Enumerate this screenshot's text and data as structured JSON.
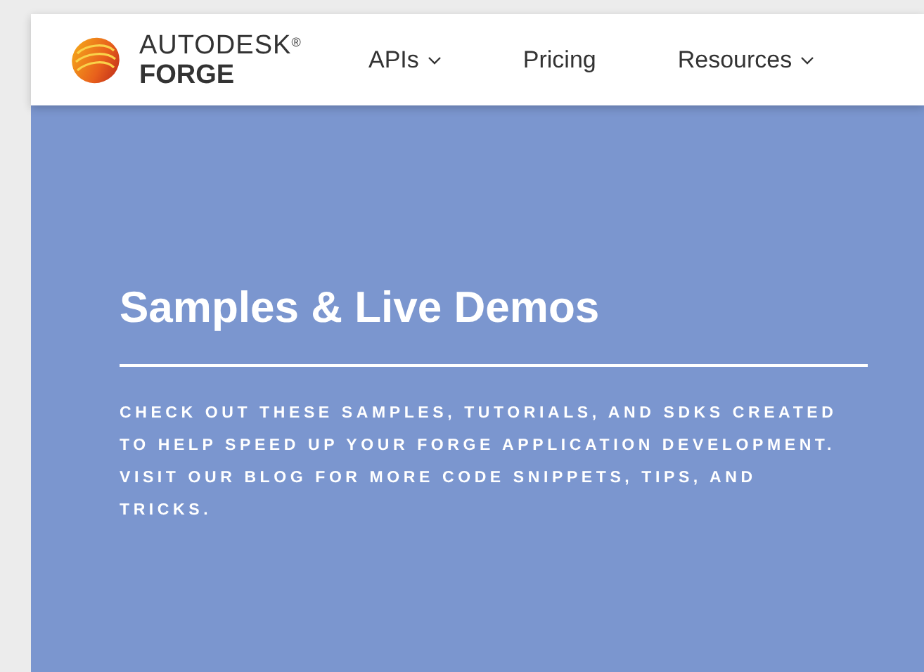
{
  "header": {
    "logo": {
      "brand": "AUTODESK",
      "registered": "®",
      "product": "FORGE"
    },
    "nav": [
      {
        "label": "APIs",
        "has_menu": true
      },
      {
        "label": "Pricing",
        "has_menu": false
      },
      {
        "label": "Resources",
        "has_menu": true
      }
    ]
  },
  "hero": {
    "title": "Samples & Live Demos",
    "description": "CHECK OUT THESE SAMPLES, TUTORIALS, AND SDKS CREATED TO HELP SPEED UP YOUR FORGE APPLICATION DEVELOPMENT. VISIT OUR BLOG FOR MORE CODE SNIPPETS, TIPS, AND TRICKS."
  }
}
